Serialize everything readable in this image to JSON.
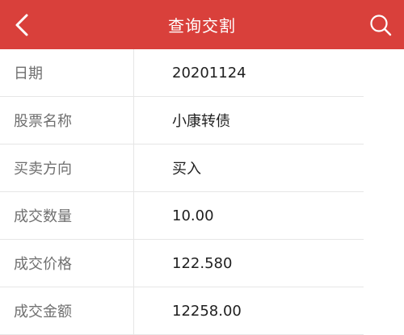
{
  "header": {
    "title": "查询交割",
    "back_icon": "chevron-left-icon",
    "search_icon": "search-icon",
    "color": "#d9403b"
  },
  "rows": [
    {
      "label": "日期",
      "value": "20201124"
    },
    {
      "label": "股票名称",
      "value": "小康转债"
    },
    {
      "label": "买卖方向",
      "value": "买入"
    },
    {
      "label": "成交数量",
      "value": "10.00"
    },
    {
      "label": "成交价格",
      "value": "122.580"
    },
    {
      "label": "成交金额",
      "value": "12258.00"
    }
  ]
}
